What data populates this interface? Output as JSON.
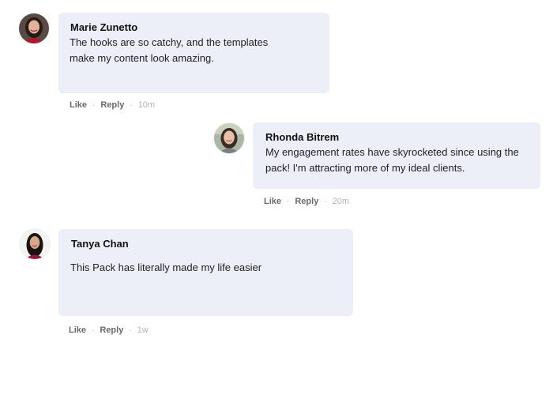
{
  "comments": [
    {
      "author": "Marie Zunetto",
      "text": "The hooks are so catchy, and the templates make my content look amazing.",
      "like_label": "Like",
      "reply_label": "Reply",
      "time": "10m",
      "avatar_icon": "avatar-photo-icon"
    },
    {
      "author": "Rhonda Bitrem",
      "text": "My engagement rates have skyrocketed since using the pack! I'm attracting more of my ideal clients.",
      "like_label": "Like",
      "reply_label": "Reply",
      "time": "20m",
      "avatar_icon": "avatar-photo-icon"
    },
    {
      "author": "Tanya Chan",
      "text": "This Pack has literally made my life easier",
      "like_label": "Like",
      "reply_label": "Reply",
      "time": "1w",
      "avatar_icon": "avatar-photo-icon"
    }
  ],
  "colors": {
    "bubble": "#eceef8",
    "action_text": "#6a6a6a",
    "timestamp": "#b5b5b5"
  }
}
